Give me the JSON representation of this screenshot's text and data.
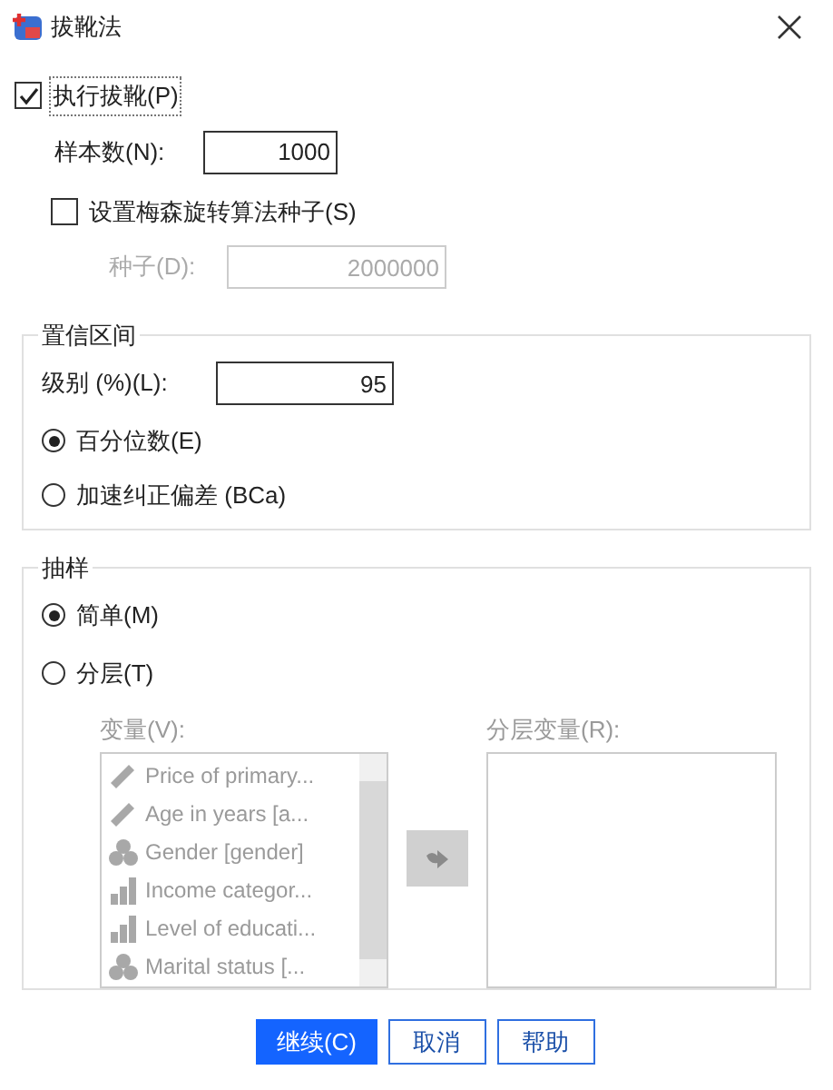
{
  "window": {
    "title": "拔靴法"
  },
  "perform": {
    "label": "执行拔靴(P)",
    "checked": true
  },
  "samples": {
    "label": "样本数(N):",
    "value": "1000"
  },
  "seed_option": {
    "label": "设置梅森旋转算法种子(S)",
    "checked": false
  },
  "seed": {
    "label": "种子(D):",
    "value": "2000000",
    "disabled": true
  },
  "confidence": {
    "title": "置信区间",
    "level_label": "级别 (%)(L):",
    "level_value": "95",
    "options": [
      {
        "label": "百分位数(E)",
        "selected": true
      },
      {
        "label": "加速纠正偏差 (BCa)",
        "selected": false
      }
    ]
  },
  "sampling": {
    "title": "抽样",
    "options": [
      {
        "label": "简单(M)",
        "selected": true
      },
      {
        "label": "分层(T)",
        "selected": false
      }
    ],
    "variables_label": "变量(V):",
    "strata_label": "分层变量(R):",
    "disabled": true,
    "variables": [
      {
        "name": "Price of primary...",
        "kind": "scale"
      },
      {
        "name": "Age in years [a...",
        "kind": "scale"
      },
      {
        "name": "Gender [gender]",
        "kind": "nominal"
      },
      {
        "name": "Income categor...",
        "kind": "ordinal"
      },
      {
        "name": "Level of educati...",
        "kind": "ordinal"
      },
      {
        "name": "Marital status [...",
        "kind": "nominal"
      }
    ]
  },
  "buttons": [
    {
      "label": "继续(C)",
      "primary": true
    },
    {
      "label": "取消",
      "primary": false
    },
    {
      "label": "帮助",
      "primary": false
    }
  ]
}
